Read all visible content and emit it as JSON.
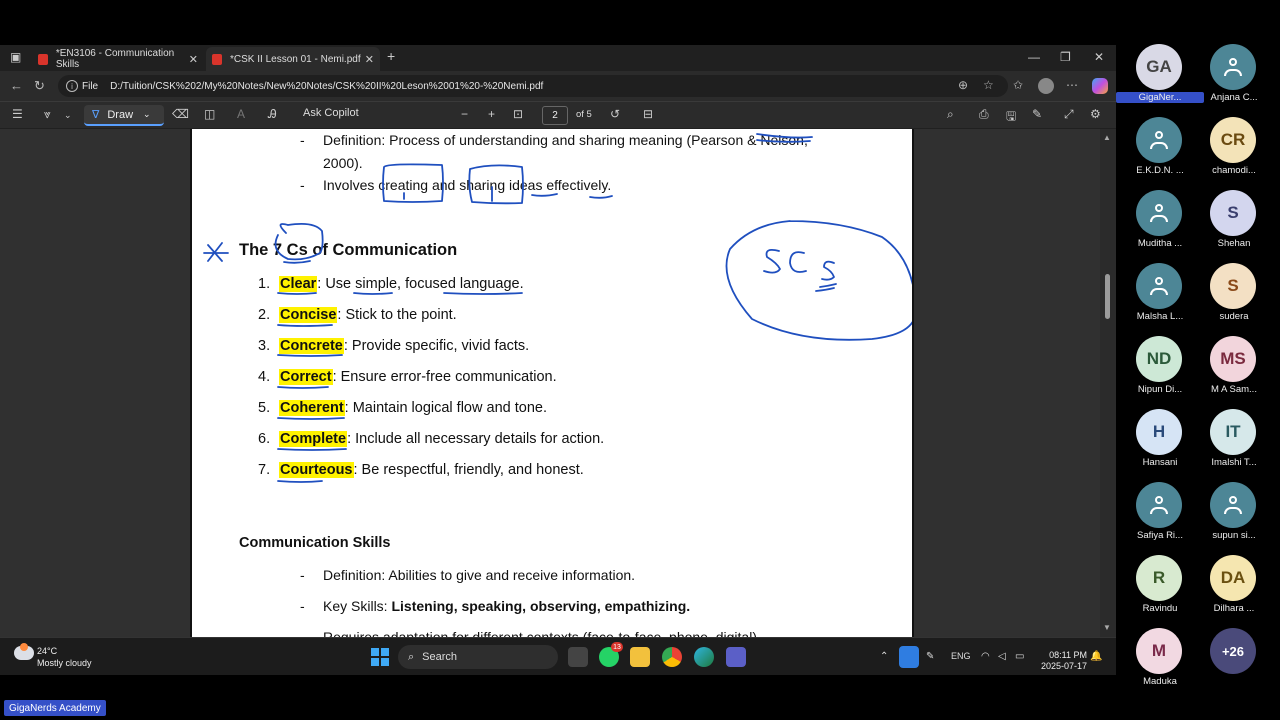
{
  "browser": {
    "tabs": [
      {
        "title": "*EN3106 - Communication Skills"
      },
      {
        "title": "*CSK II Lesson 01 - Nemi.pdf"
      }
    ],
    "new_tab_label": "+",
    "address_label": "File",
    "url": "D:/Tuition/CSK%202/My%20Notes/New%20Notes/CSK%20II%20Leson%2001%20-%20Nemi.pdf"
  },
  "pdf_toolbar": {
    "draw_label": "Draw",
    "ask_copilot": "Ask Copilot",
    "zoom_out": "−",
    "zoom_in": "+",
    "page_current": "2",
    "page_total": "of 5"
  },
  "document": {
    "intro_lines": [
      "Definition: Process of understanding and sharing meaning (Pearson & Nelson,",
      "2000).",
      "Involves creating and sharing ideas effectively."
    ],
    "dash": "-",
    "seven_cs_heading": "The 7 Cs of Communication",
    "seven_cs": [
      {
        "num": "1.",
        "term": "Clear",
        "desc": ": Use simple, focused language."
      },
      {
        "num": "2.",
        "term": "Concise",
        "desc": ": Stick to the point."
      },
      {
        "num": "3.",
        "term": "Concrete",
        "desc": ": Provide specific, vivid facts."
      },
      {
        "num": "4.",
        "term": "Correct",
        "desc": ": Ensure error-free communication."
      },
      {
        "num": "5.",
        "term": "Coherent",
        "desc": ": Maintain logical flow and tone."
      },
      {
        "num": "6.",
        "term": "Complete",
        "desc": ": Include all necessary details for action."
      },
      {
        "num": "7.",
        "term": "Courteous",
        "desc": ": Be respectful, friendly, and honest."
      }
    ],
    "skills_heading": "Communication Skills",
    "skills_definition": "Definition: Abilities to give and receive information.",
    "key_skills_label": "Key Skills: ",
    "key_skills_value": "Listening, speaking, observing, empathizing.",
    "cut_off_line": "Requires adaptation for different contexts (face-to-face, phone, digital)."
  },
  "annotation_text": "SCS",
  "taskbar": {
    "temperature": "24°C",
    "weather": "Mostly cloudy",
    "search_label": "Search",
    "language": "ENG",
    "time": "08:11 PM",
    "date": "2025-07-17",
    "teams_badge": "13"
  },
  "participants": [
    {
      "initials": "GA",
      "name": "GigaNer...",
      "color": "#d9d9e6",
      "text_color": "#444"
    },
    {
      "initials": "",
      "name": "Anjana C...",
      "color": "#4d8696",
      "text_color": "#fff"
    },
    {
      "initials": "",
      "name": "E.K.D.N. ...",
      "color": "#4d8696",
      "text_color": "#fff"
    },
    {
      "initials": "CR",
      "name": "chamodi...",
      "color": "#f3e3b8",
      "text_color": "#6a4a10"
    },
    {
      "initials": "",
      "name": "Muditha ...",
      "color": "#4d8696",
      "text_color": "#fff"
    },
    {
      "initials": "S",
      "name": "Shehan",
      "color": "#d3d6ee",
      "text_color": "#3a3f6e"
    },
    {
      "initials": "",
      "name": "Malsha L...",
      "color": "#4d8696",
      "text_color": "#fff"
    },
    {
      "initials": "S",
      "name": "sudera",
      "color": "#f3e0c4",
      "text_color": "#8a4a1a"
    },
    {
      "initials": "ND",
      "name": "Nipun Di...",
      "color": "#cde8d6",
      "text_color": "#2b5a3a"
    },
    {
      "initials": "MS",
      "name": "M A Sam...",
      "color": "#f2d5dc",
      "text_color": "#7a2a3e"
    },
    {
      "initials": "H",
      "name": "Hansani",
      "color": "#d6e4f5",
      "text_color": "#2a4a7a"
    },
    {
      "initials": "IT",
      "name": "Imalshi T...",
      "color": "#d6e8ea",
      "text_color": "#2a5a60"
    },
    {
      "initials": "",
      "name": "Safiya Ri...",
      "color": "#4d8696",
      "text_color": "#fff"
    },
    {
      "initials": "",
      "name": "supun si...",
      "color": "#4d8696",
      "text_color": "#fff"
    },
    {
      "initials": "R",
      "name": "Ravindu",
      "color": "#d8ead0",
      "text_color": "#3a5a2a"
    },
    {
      "initials": "DA",
      "name": "Dilhara ...",
      "color": "#f5e6b0",
      "text_color": "#6a5010"
    },
    {
      "initials": "M",
      "name": "Maduka",
      "color": "#f2d9e2",
      "text_color": "#7a2a4a"
    },
    {
      "initials": "+26",
      "name": "",
      "color": "#4a4a7a",
      "text_color": "#fff"
    }
  ],
  "academy_label": "GigaNerds Academy"
}
